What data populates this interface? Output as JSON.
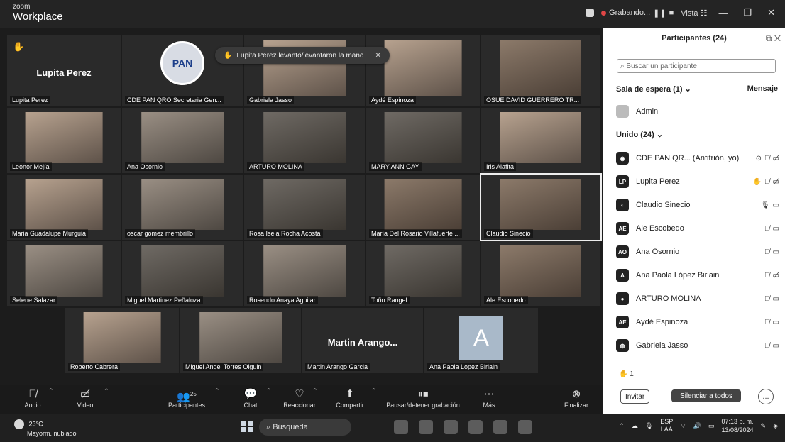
{
  "titlebar": {
    "brand_small": "zoom",
    "brand": "Workplace",
    "recording": "Grabando...",
    "view": "Vista"
  },
  "toast": {
    "text": "Lupita Perez levantó/levantaron la mano"
  },
  "tiles": [
    {
      "name": "Lupita Perez",
      "big": "Lupita Perez"
    },
    {
      "name": "CDE PAN QRO Secretaria Gen..."
    },
    {
      "name": "Gabriela Jasso"
    },
    {
      "name": "Aydé Espinoza"
    },
    {
      "name": "OSUE DAVID GUERRERO TR..."
    },
    {
      "name": "Leonor Mejía"
    },
    {
      "name": "Ana Osornio"
    },
    {
      "name": "ARTURO MOLINA"
    },
    {
      "name": "MARY ANN GAY"
    },
    {
      "name": "Iris Alafita"
    },
    {
      "name": "Maria Guadalupe Murguia"
    },
    {
      "name": "oscar gomez membrillo"
    },
    {
      "name": "Rosa Isela Rocha Acosta"
    },
    {
      "name": "María Del Rosario Villafuerte ..."
    },
    {
      "name": "Claudio Sinecio"
    },
    {
      "name": "Selene Salazar"
    },
    {
      "name": "Miguel Martinez Peñaloza"
    },
    {
      "name": "Rosendo Anaya Aguilar"
    },
    {
      "name": "Toño Rangel"
    },
    {
      "name": "Ale Escobedo"
    },
    {
      "name": "Roberto Cabrera"
    },
    {
      "name": "Miguel Angel Torres Olguin"
    },
    {
      "name": "Martin Arango Garcia",
      "big": "Martin Arango..."
    },
    {
      "name": "Ana Paola Lopez Birlain",
      "avatar": "A"
    }
  ],
  "toolbar": {
    "audio": "Audio",
    "video": "Video",
    "participants": "Participantes",
    "participants_count": "25",
    "chat": "Chat",
    "react": "Reaccionar",
    "share": "Compartir",
    "record": "Pausar/detener grabación",
    "more": "Más",
    "end": "Finalizar"
  },
  "panel": {
    "title": "Participantes (24)",
    "search_placeholder": "Buscar un participante",
    "waiting": "Sala de espera (1)",
    "message": "Mensaje",
    "waiting_user": "Admin",
    "joined": "Unido (24)",
    "people": [
      {
        "initials": "",
        "name": "CDE PAN QR... (Anfitrión, yo)"
      },
      {
        "initials": "LP",
        "name": "Lupita Perez"
      },
      {
        "initials": "",
        "name": "Claudio Sinecio"
      },
      {
        "initials": "AE",
        "name": "Ale Escobedo"
      },
      {
        "initials": "AO",
        "name": "Ana Osornio"
      },
      {
        "initials": "A",
        "name": "Ana Paola López Birlain"
      },
      {
        "initials": "",
        "name": "ARTURO MOLINA"
      },
      {
        "initials": "AE",
        "name": "Aydé Espinoza"
      },
      {
        "initials": "",
        "name": "Gabriela Jasso"
      }
    ],
    "hand_count": "1",
    "invite": "Invitar",
    "mute_all": "Silenciar a todos",
    "more": "..."
  },
  "taskbar": {
    "temp": "23°C",
    "weather": "Mayorm. nublado",
    "search": "Búsqueda",
    "lang1": "ESP",
    "lang2": "LAA",
    "time": "07:13 p. m.",
    "date": "13/08/2024"
  }
}
